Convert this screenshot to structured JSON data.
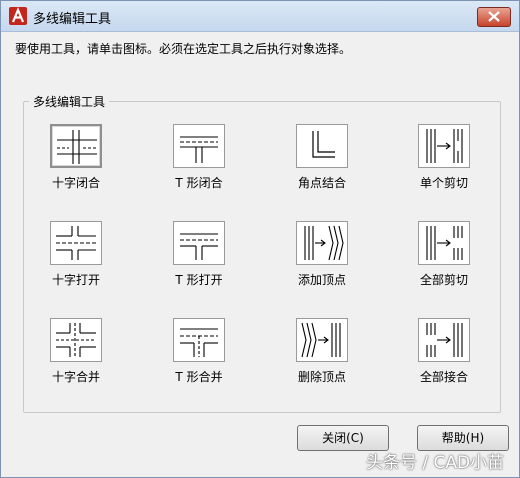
{
  "window": {
    "title": "多线编辑工具"
  },
  "instruction": "要使用工具，请单击图标。必须在选定工具之后执行对象选择。",
  "group": {
    "label": "多线编辑工具"
  },
  "tools": [
    {
      "label": "十字闭合",
      "icon": "closed-cross-icon",
      "selected": true
    },
    {
      "label": "T 形闭合",
      "icon": "closed-tee-icon"
    },
    {
      "label": "角点结合",
      "icon": "corner-joint-icon"
    },
    {
      "label": "单个剪切",
      "icon": "cut-single-icon"
    },
    {
      "label": "十字打开",
      "icon": "open-cross-icon"
    },
    {
      "label": "T 形打开",
      "icon": "open-tee-icon"
    },
    {
      "label": "添加顶点",
      "icon": "add-vertex-icon"
    },
    {
      "label": "全部剪切",
      "icon": "cut-all-icon"
    },
    {
      "label": "十字合并",
      "icon": "merged-cross-icon"
    },
    {
      "label": "T 形合并",
      "icon": "merged-tee-icon"
    },
    {
      "label": "删除顶点",
      "icon": "delete-vertex-icon"
    },
    {
      "label": "全部接合",
      "icon": "weld-all-icon"
    }
  ],
  "buttons": {
    "close": "关闭(C)",
    "help": "帮助(H)"
  },
  "watermark": "头条号 / CAD小苗"
}
